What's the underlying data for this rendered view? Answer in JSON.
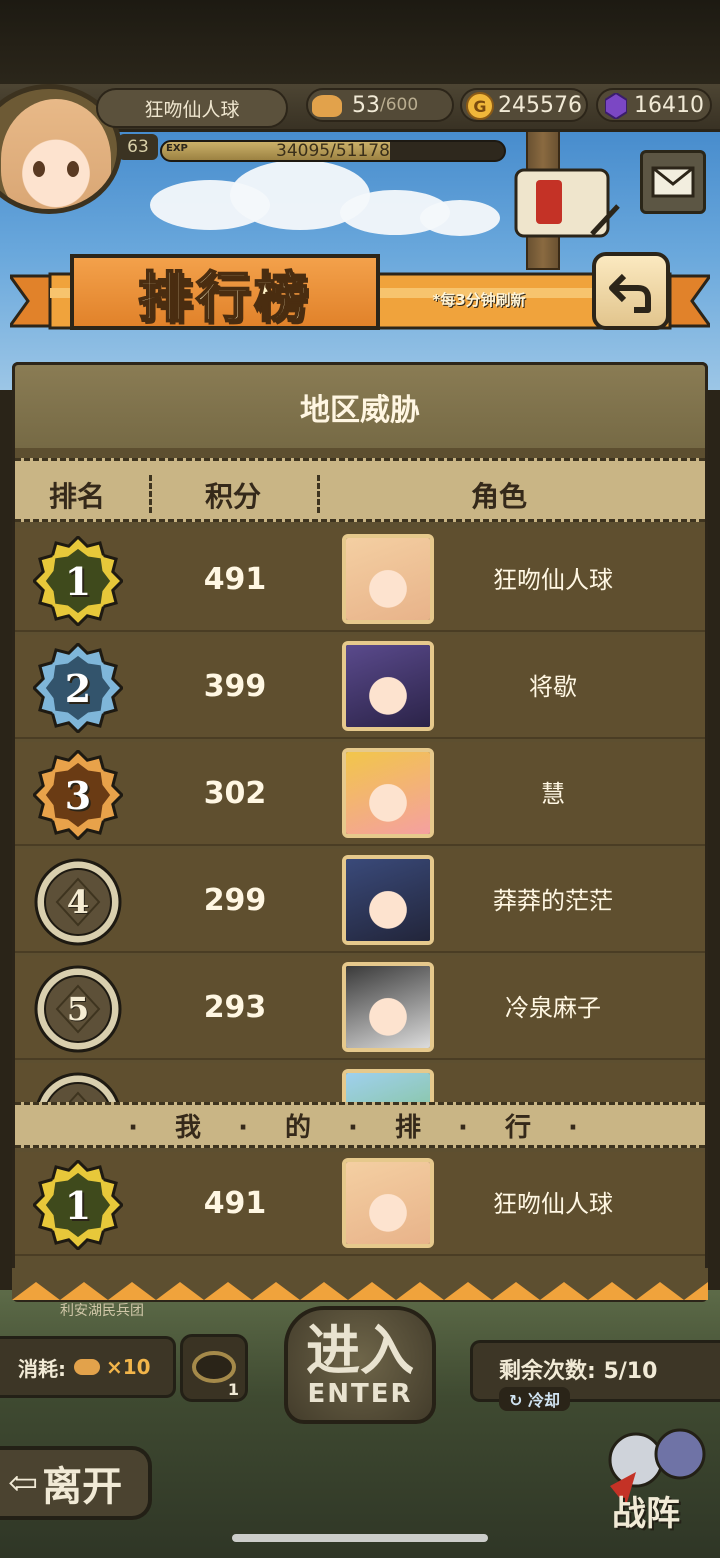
{
  "player": {
    "name": "狂吻仙人球",
    "level": "63",
    "exp_tag": "EXP",
    "exp_text": "34095/51178",
    "exp_fraction": 0.666
  },
  "resources": {
    "stamina_value": "53",
    "stamina_max": "/600",
    "gold_icon": "G",
    "gold": "245576",
    "gems": "16410"
  },
  "banner": {
    "title": "排行榜",
    "refresh_note": "*每3分钟刷新"
  },
  "panel": {
    "title": "地区威胁",
    "columns": [
      "排名",
      "积分",
      "角色"
    ]
  },
  "ranking": [
    {
      "rank": "1",
      "score": "491",
      "name": "狂吻仙人球"
    },
    {
      "rank": "2",
      "score": "399",
      "name": "将歇"
    },
    {
      "rank": "3",
      "score": "302",
      "name": "慧"
    },
    {
      "rank": "4",
      "score": "299",
      "name": "莽莽的茫茫"
    },
    {
      "rank": "5",
      "score": "293",
      "name": "冷泉麻子"
    }
  ],
  "my_rank": {
    "title": "· 我 · 的 · 排 · 行 ·",
    "rank": "1",
    "score": "491",
    "name": "狂吻仙人球"
  },
  "bottom": {
    "cost_label": "消耗:",
    "cost_mult": "×10",
    "item_count": "1",
    "enter_zh": "进入",
    "enter_en": "ENTER",
    "remain_text": "剩余次数: 5/10",
    "cooldown": "冷却",
    "leave": "离开",
    "formation": "战阵",
    "team_label": "利安湖民兵团"
  },
  "colors": {
    "gold_medal": "#e7c83a",
    "silver_medal": "#7fb6d9",
    "bronze_medal": "#e8a24a",
    "plain_medal": "#6f6347",
    "accent_orange": "#e1822a"
  }
}
